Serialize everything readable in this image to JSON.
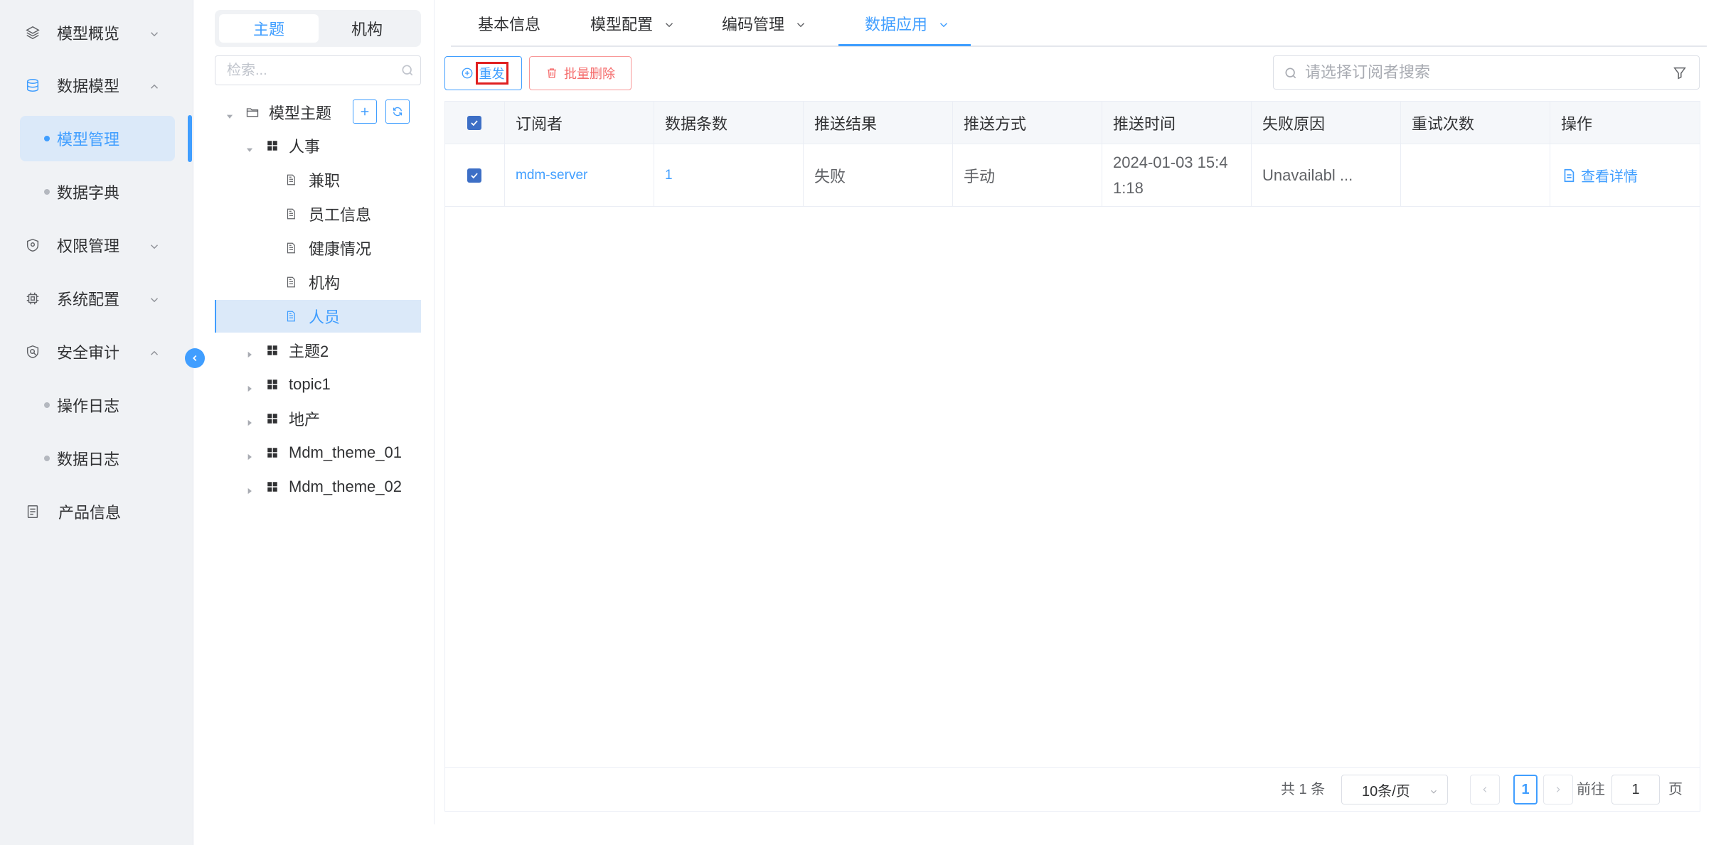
{
  "sidebar": {
    "menus": [
      {
        "label": "模型概览",
        "icon": "layers-icon",
        "expanded": false
      },
      {
        "label": "数据模型",
        "icon": "database-icon",
        "expanded": true,
        "children": [
          {
            "label": "模型管理",
            "active": true
          },
          {
            "label": "数据字典",
            "active": false
          }
        ]
      },
      {
        "label": "权限管理",
        "icon": "shield-icon",
        "expanded": false
      },
      {
        "label": "系统配置",
        "icon": "chip-icon",
        "expanded": false
      },
      {
        "label": "安全审计",
        "icon": "audit-icon",
        "expanded": true,
        "children": [
          {
            "label": "操作日志",
            "active": false
          },
          {
            "label": "数据日志",
            "active": false
          }
        ]
      },
      {
        "label": "产品信息",
        "icon": "document-list-icon",
        "expanded": false
      }
    ]
  },
  "tree": {
    "segments": [
      {
        "label": "主题",
        "active": true
      },
      {
        "label": "机构",
        "active": false
      }
    ],
    "search_placeholder": "检索...",
    "root": {
      "label": "模型主题"
    },
    "nodes": [
      {
        "label": "人事",
        "type": "group",
        "expanded": true
      },
      {
        "label": "兼职",
        "type": "leaf"
      },
      {
        "label": "员工信息",
        "type": "leaf"
      },
      {
        "label": "健康情况",
        "type": "leaf"
      },
      {
        "label": "机构",
        "type": "leaf"
      },
      {
        "label": "人员",
        "type": "leaf",
        "selected": true
      },
      {
        "label": "主题2",
        "type": "group"
      },
      {
        "label": "topic1",
        "type": "group"
      },
      {
        "label": "地产",
        "type": "group"
      },
      {
        "label": "Mdm_theme_01",
        "type": "group"
      },
      {
        "label": "Mdm_theme_02",
        "type": "group"
      }
    ]
  },
  "tabs": [
    {
      "label": "基本信息",
      "dropdown": false,
      "active": false
    },
    {
      "label": "模型配置",
      "dropdown": true,
      "active": false
    },
    {
      "label": "编码管理",
      "dropdown": true,
      "active": false
    },
    {
      "label": "数据应用",
      "dropdown": true,
      "active": true
    }
  ],
  "toolbar": {
    "retry_label": "重发",
    "batch_delete_label": "批量删除",
    "subscriber_search_placeholder": "请选择订阅者搜索"
  },
  "table": {
    "columns": [
      "订阅者",
      "数据条数",
      "推送结果",
      "推送方式",
      "推送时间",
      "失败原因",
      "重试次数",
      "操作"
    ],
    "rows": [
      {
        "subscriber": "mdm-server",
        "count": "1",
        "result": "失败",
        "method": "手动",
        "time_line1": "2024-01-03 15:4",
        "time_line2": "1:18",
        "reason": "Unavailabl ...",
        "retries": "",
        "action": "查看详情",
        "checked": true
      }
    ],
    "header_checked": true
  },
  "pagination": {
    "total": "共 1 条",
    "page_size": "10条/页",
    "current_page": "1",
    "goto_label": "前往",
    "goto_value": "1",
    "page_suffix": "页"
  },
  "colors": {
    "accent": "#409eff",
    "danger": "#f56c6c",
    "sidebar_bg": "#f0f2f5",
    "selected_bg": "#dbe9f9"
  }
}
